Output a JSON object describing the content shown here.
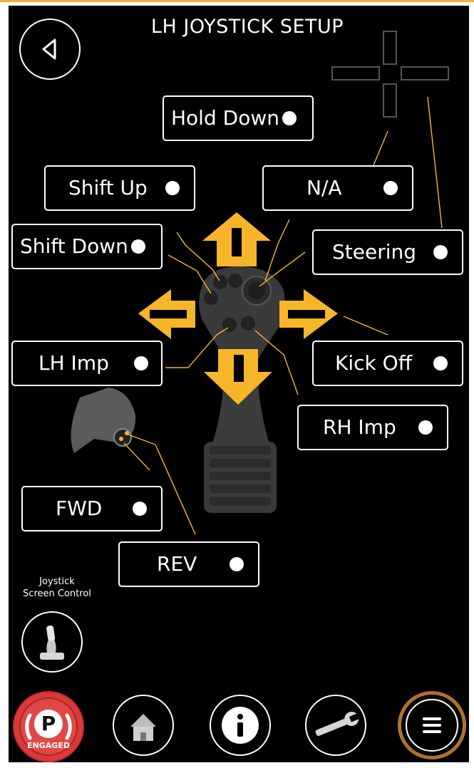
{
  "header": {
    "title": "LH JOYSTICK SETUP",
    "back_icon": "back-arrow-icon"
  },
  "colors": {
    "accent": "#f7b529",
    "background": "#000000",
    "foreground": "#ffffff",
    "park": "#d93535"
  },
  "buttons": {
    "hold_down": "Hold Down",
    "shift_up": "Shift Up",
    "na": "N/A",
    "shift_down": "Shift Down",
    "steering": "Steering",
    "lh_imp": "LH Imp",
    "kick_off": "Kick Off",
    "rh_imp": "RH Imp",
    "fwd": "FWD",
    "rev": "REV"
  },
  "joystick_screen_control": {
    "line1": "Joystick",
    "line2": "Screen Control",
    "icon": "joystick-icon"
  },
  "nav": {
    "park": {
      "letter": "P",
      "text": "ENGAGED",
      "icon": "parking-brake-icon"
    },
    "home_icon": "home-icon",
    "info_icon": "info-icon",
    "tools_icon": "wrench-icon",
    "menu_icon": "menu-icon"
  }
}
